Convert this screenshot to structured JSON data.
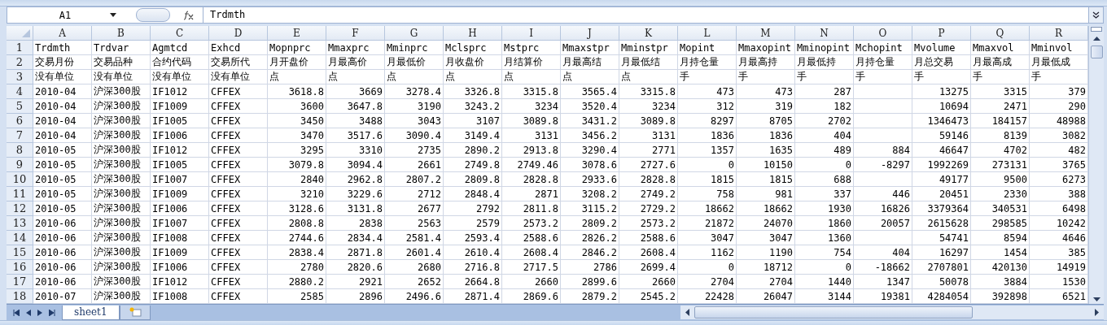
{
  "formula_bar": {
    "name_box": "A1",
    "formula": "Trdmth"
  },
  "columns": [
    {
      "label": "A",
      "kind": "text"
    },
    {
      "label": "B",
      "kind": "text"
    },
    {
      "label": "C",
      "kind": "text"
    },
    {
      "label": "D",
      "kind": "text"
    },
    {
      "label": "E",
      "kind": "number"
    },
    {
      "label": "F",
      "kind": "number"
    },
    {
      "label": "G",
      "kind": "number"
    },
    {
      "label": "H",
      "kind": "number"
    },
    {
      "label": "I",
      "kind": "number"
    },
    {
      "label": "J",
      "kind": "number"
    },
    {
      "label": "K",
      "kind": "number"
    },
    {
      "label": "L",
      "kind": "number"
    },
    {
      "label": "M",
      "kind": "number"
    },
    {
      "label": "N",
      "kind": "number"
    },
    {
      "label": "O",
      "kind": "number"
    },
    {
      "label": "P",
      "kind": "number"
    },
    {
      "label": "Q",
      "kind": "number"
    },
    {
      "label": "R",
      "kind": "number"
    }
  ],
  "rows": [
    {
      "number": "1",
      "kind": "header",
      "cells": [
        "Trdmth",
        "Trdvar",
        "Agmtcd",
        "Exhcd",
        "Mopnprc",
        "Mmaxprc",
        "Mminprc",
        "Mclsprc",
        "Mstprc",
        "Mmaxstpr",
        "Mminstpr",
        "Mopint",
        "Mmaxopint",
        "Mminopint",
        "Mchopint",
        "Mvolume",
        "Mmaxvol",
        "Mminvol"
      ]
    },
    {
      "number": "2",
      "kind": "header",
      "cells": [
        "交易月份",
        "交易品种",
        "合约代码",
        "交易所代",
        "月开盘价",
        "月最高价",
        "月最低价",
        "月收盘价",
        "月结算价",
        "月最高结",
        "月最低结",
        "月持仓量",
        "月最高持",
        "月最低持",
        "月持仓量",
        "月总交易",
        "月最高成",
        "月最低成"
      ]
    },
    {
      "number": "3",
      "kind": "header",
      "cells": [
        "没有单位",
        "没有单位",
        "没有单位",
        "没有单位",
        "点",
        "点",
        "点",
        "点",
        "点",
        "点",
        "点",
        "手",
        "手",
        "手",
        "手",
        "手",
        "手",
        "手"
      ]
    },
    {
      "number": "4",
      "kind": "data",
      "cells": [
        "2010-04",
        "沪深300股",
        "IF1012",
        "CFFEX",
        "3618.8",
        "3669",
        "3278.4",
        "3326.8",
        "3315.8",
        "3565.4",
        "3315.8",
        "473",
        "473",
        "287",
        null,
        "13275",
        "3315",
        "379"
      ]
    },
    {
      "number": "5",
      "kind": "data",
      "cells": [
        "2010-04",
        "沪深300股",
        "IF1009",
        "CFFEX",
        "3600",
        "3647.8",
        "3190",
        "3243.2",
        "3234",
        "3520.4",
        "3234",
        "312",
        "319",
        "182",
        null,
        "10694",
        "2471",
        "290"
      ]
    },
    {
      "number": "6",
      "kind": "data",
      "cells": [
        "2010-04",
        "沪深300股",
        "IF1005",
        "CFFEX",
        "3450",
        "3488",
        "3043",
        "3107",
        "3089.8",
        "3431.2",
        "3089.8",
        "8297",
        "8705",
        "2702",
        null,
        "1346473",
        "184157",
        "48988"
      ]
    },
    {
      "number": "7",
      "kind": "data",
      "cells": [
        "2010-04",
        "沪深300股",
        "IF1006",
        "CFFEX",
        "3470",
        "3517.6",
        "3090.4",
        "3149.4",
        "3131",
        "3456.2",
        "3131",
        "1836",
        "1836",
        "404",
        null,
        "59146",
        "8139",
        "3082"
      ]
    },
    {
      "number": "8",
      "kind": "data",
      "cells": [
        "2010-05",
        "沪深300股",
        "IF1012",
        "CFFEX",
        "3295",
        "3310",
        "2735",
        "2890.2",
        "2913.8",
        "3290.4",
        "2771",
        "1357",
        "1635",
        "489",
        "884",
        "46647",
        "4702",
        "482"
      ]
    },
    {
      "number": "9",
      "kind": "data",
      "cells": [
        "2010-05",
        "沪深300股",
        "IF1005",
        "CFFEX",
        "3079.8",
        "3094.4",
        "2661",
        "2749.8",
        "2749.46",
        "3078.6",
        "2727.6",
        "0",
        "10150",
        "0",
        "-8297",
        "1992269",
        "273131",
        "3765"
      ]
    },
    {
      "number": "10",
      "kind": "data",
      "cells": [
        "2010-05",
        "沪深300股",
        "IF1007",
        "CFFEX",
        "2840",
        "2962.8",
        "2807.2",
        "2809.8",
        "2828.8",
        "2933.6",
        "2828.8",
        "1815",
        "1815",
        "688",
        null,
        "49177",
        "9500",
        "6273"
      ]
    },
    {
      "number": "11",
      "kind": "data",
      "cells": [
        "2010-05",
        "沪深300股",
        "IF1009",
        "CFFEX",
        "3210",
        "3229.6",
        "2712",
        "2848.4",
        "2871",
        "3208.2",
        "2749.2",
        "758",
        "981",
        "337",
        "446",
        "20451",
        "2330",
        "388"
      ]
    },
    {
      "number": "12",
      "kind": "data",
      "cells": [
        "2010-05",
        "沪深300股",
        "IF1006",
        "CFFEX",
        "3128.6",
        "3131.8",
        "2677",
        "2792",
        "2811.8",
        "3115.2",
        "2729.2",
        "18662",
        "18662",
        "1930",
        "16826",
        "3379364",
        "340531",
        "6498"
      ]
    },
    {
      "number": "13",
      "kind": "data",
      "cells": [
        "2010-06",
        "沪深300股",
        "IF1007",
        "CFFEX",
        "2808.8",
        "2838",
        "2563",
        "2579",
        "2573.2",
        "2809.2",
        "2573.2",
        "21872",
        "24070",
        "1860",
        "20057",
        "2615628",
        "298585",
        "10242"
      ]
    },
    {
      "number": "14",
      "kind": "data",
      "cells": [
        "2010-06",
        "沪深300股",
        "IF1008",
        "CFFEX",
        "2744.6",
        "2834.4",
        "2581.4",
        "2593.4",
        "2588.6",
        "2826.2",
        "2588.6",
        "3047",
        "3047",
        "1360",
        null,
        "54741",
        "8594",
        "4646"
      ]
    },
    {
      "number": "15",
      "kind": "data",
      "cells": [
        "2010-06",
        "沪深300股",
        "IF1009",
        "CFFEX",
        "2838.4",
        "2871.8",
        "2601.4",
        "2610.4",
        "2608.4",
        "2846.2",
        "2608.4",
        "1162",
        "1190",
        "754",
        "404",
        "16297",
        "1454",
        "385"
      ]
    },
    {
      "number": "16",
      "kind": "data",
      "cells": [
        "2010-06",
        "沪深300股",
        "IF1006",
        "CFFEX",
        "2780",
        "2820.6",
        "2680",
        "2716.8",
        "2717.5",
        "2786",
        "2699.4",
        "0",
        "18712",
        "0",
        "-18662",
        "2707801",
        "420130",
        "14919"
      ]
    },
    {
      "number": "17",
      "kind": "data",
      "cells": [
        "2010-06",
        "沪深300股",
        "IF1012",
        "CFFEX",
        "2880.2",
        "2921",
        "2652",
        "2664.8",
        "2660",
        "2899.6",
        "2660",
        "2704",
        "2704",
        "1440",
        "1347",
        "50078",
        "3884",
        "1530"
      ]
    },
    {
      "number": "18",
      "kind": "data",
      "cells": [
        "2010-07",
        "沪深300股",
        "IF1008",
        "CFFEX",
        "2585",
        "2896",
        "2496.6",
        "2871.4",
        "2869.6",
        "2879.2",
        "2545.2",
        "22428",
        "26047",
        "3144",
        "19381",
        "4284054",
        "392898",
        "6521"
      ]
    }
  ],
  "sheet_tabs": [
    {
      "label": "sheet1",
      "selected": true
    }
  ]
}
